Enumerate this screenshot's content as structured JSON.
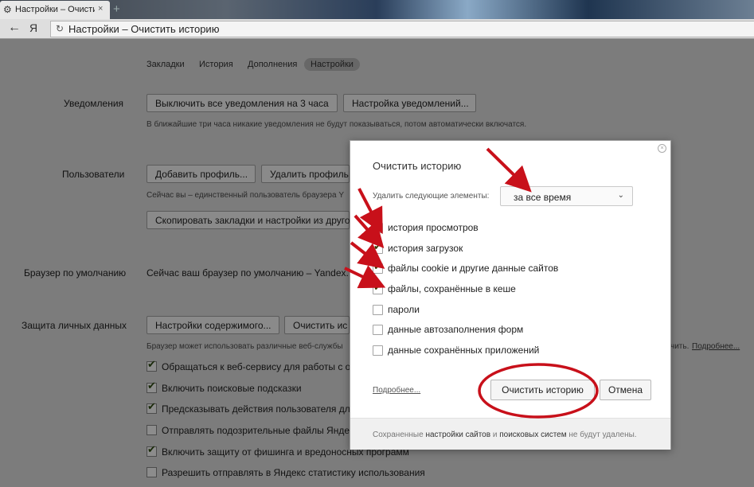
{
  "browser": {
    "tab_title": "Настройки – Очистит",
    "tab_close": "×",
    "new_tab": "+",
    "back_icon": "arrow-left-icon",
    "logo": "Я",
    "reload_icon": "reload-icon",
    "address_text": "Настройки – Очистить историю"
  },
  "nav": {
    "items": [
      "Закладки",
      "История",
      "Дополнения",
      "Настройки"
    ],
    "active": "Настройки"
  },
  "sections": {
    "notifications": {
      "label": "Уведомления",
      "btn_disable": "Выключить все уведомления на 3 часа",
      "btn_settings": "Настройка уведомлений...",
      "hint": "В ближайшие три часа никакие уведомления не будут показываться, потом автоматически включатся."
    },
    "users": {
      "label": "Пользователи",
      "btn_add": "Добавить профиль...",
      "btn_delete": "Удалить профиль",
      "hint": "Сейчас вы – единственный пользователь браузера Y",
      "btn_copy": "Скопировать закладки и настройки из друго"
    },
    "default_browser": {
      "label": "Браузер по умолчанию",
      "text": "Сейчас ваш браузер по умолчанию – Yandex."
    },
    "privacy": {
      "label": "Защита личных данных",
      "btn_content": "Настройки содержимого...",
      "btn_clear": "Очистить ис",
      "hint": "Браузер может использовать различные веб-службы",
      "hint_tail": "чить.",
      "more_link": "Подробнее...",
      "checks": [
        {
          "label": "Обращаться к веб-сервису для работы с о",
          "checked": true
        },
        {
          "label": "Включить поисковые подсказки",
          "checked": true
        },
        {
          "label": "Предсказывать действия пользователя дл",
          "checked": true
        },
        {
          "label": "Отправлять подозрительные файлы Яндек",
          "checked": false
        },
        {
          "label": "Включить защиту от фишинга и вредоносных программ",
          "checked": true
        },
        {
          "label": "Разрешить отправлять в Яндекс статистику использования",
          "checked": false
        }
      ]
    }
  },
  "dialog": {
    "title": "Очистить историю",
    "close": "×",
    "delete_label": "Удалить следующие элементы:",
    "period_value": "за все время",
    "options": [
      {
        "label": "история просмотров",
        "checked": true
      },
      {
        "label": "история загрузок",
        "checked": true
      },
      {
        "label": "файлы cookie и другие данные сайтов",
        "checked": true
      },
      {
        "label": "файлы, сохранённые в кеше",
        "checked": true
      },
      {
        "label": "пароли",
        "checked": false
      },
      {
        "label": "данные автозаполнения форм",
        "checked": false
      },
      {
        "label": "данные сохранённых приложений",
        "checked": false
      }
    ],
    "more_link": "Подробнее...",
    "btn_clear": "Очистить историю",
    "btn_cancel": "Отмена",
    "footer_1": "Сохраненные ",
    "footer_2": "настройки сайтов",
    "footer_3": " и ",
    "footer_4": "поисковых систем",
    "footer_5": " не будут удалены."
  },
  "annotation_color": "#c8101a"
}
